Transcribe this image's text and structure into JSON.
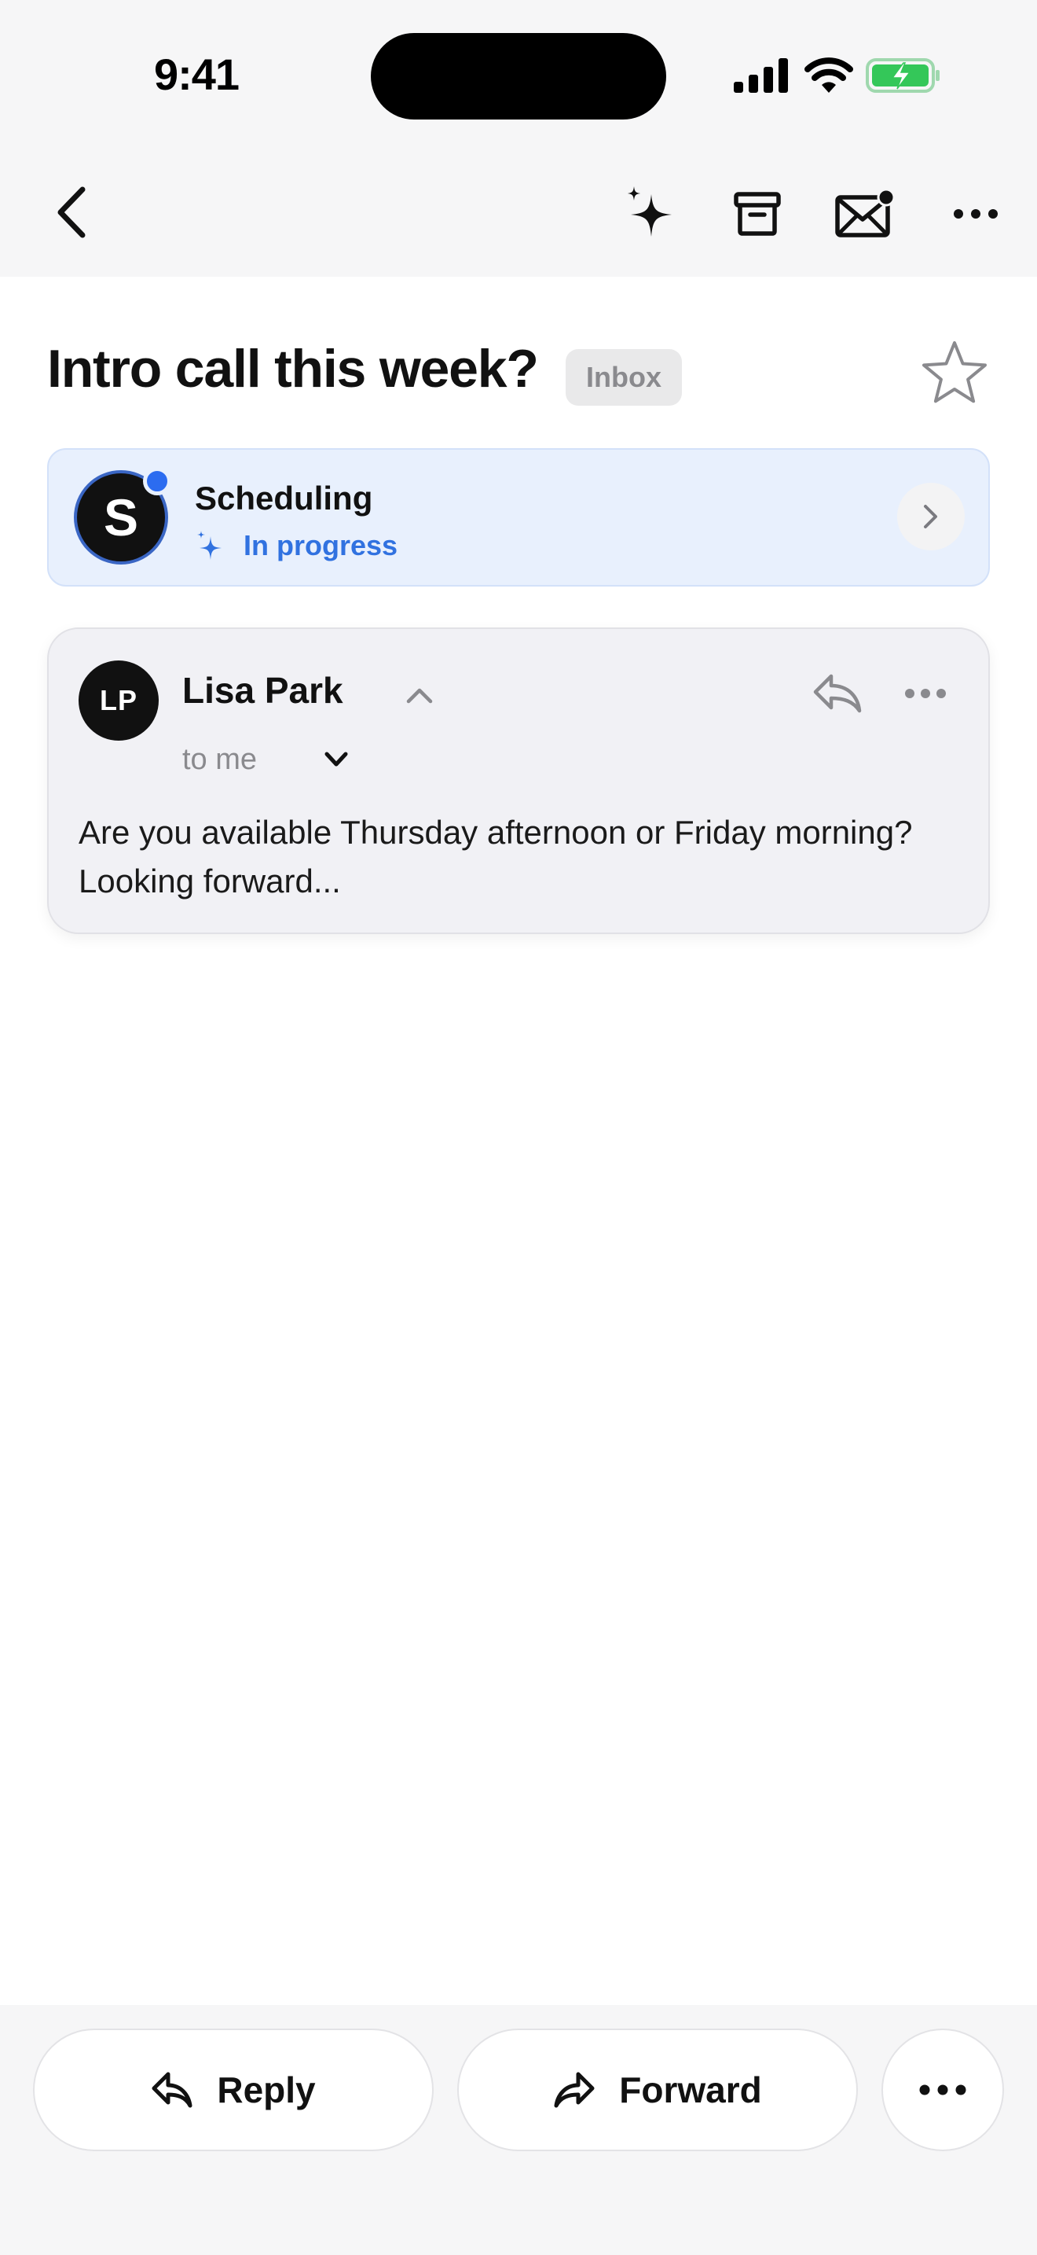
{
  "status_bar": {
    "time": "9:41",
    "icons": [
      "signal-icon",
      "wifi-icon",
      "battery-charging-icon"
    ],
    "battery_color": "#34c759"
  },
  "toolbar": {
    "icons": [
      "back-chevron-icon",
      "sparkle-icon",
      "archive-icon",
      "unread-mail-icon",
      "more-icon"
    ]
  },
  "email": {
    "subject": "Intro call this week?",
    "folder_badge": "Inbox",
    "starred": false
  },
  "agent_card": {
    "avatar_letter": "S",
    "title": "Scheduling",
    "status": "In progress",
    "accent_color": "#3172e0",
    "background_color": "#e8f0fd"
  },
  "message": {
    "sender_initials": "LP",
    "sender_name": "Lisa Park",
    "recipient": "to me",
    "preview": "Are you available Thursday afternoon or Friday morning? Looking forward..."
  },
  "actions": {
    "reply_label": "Reply",
    "forward_label": "Forward"
  }
}
